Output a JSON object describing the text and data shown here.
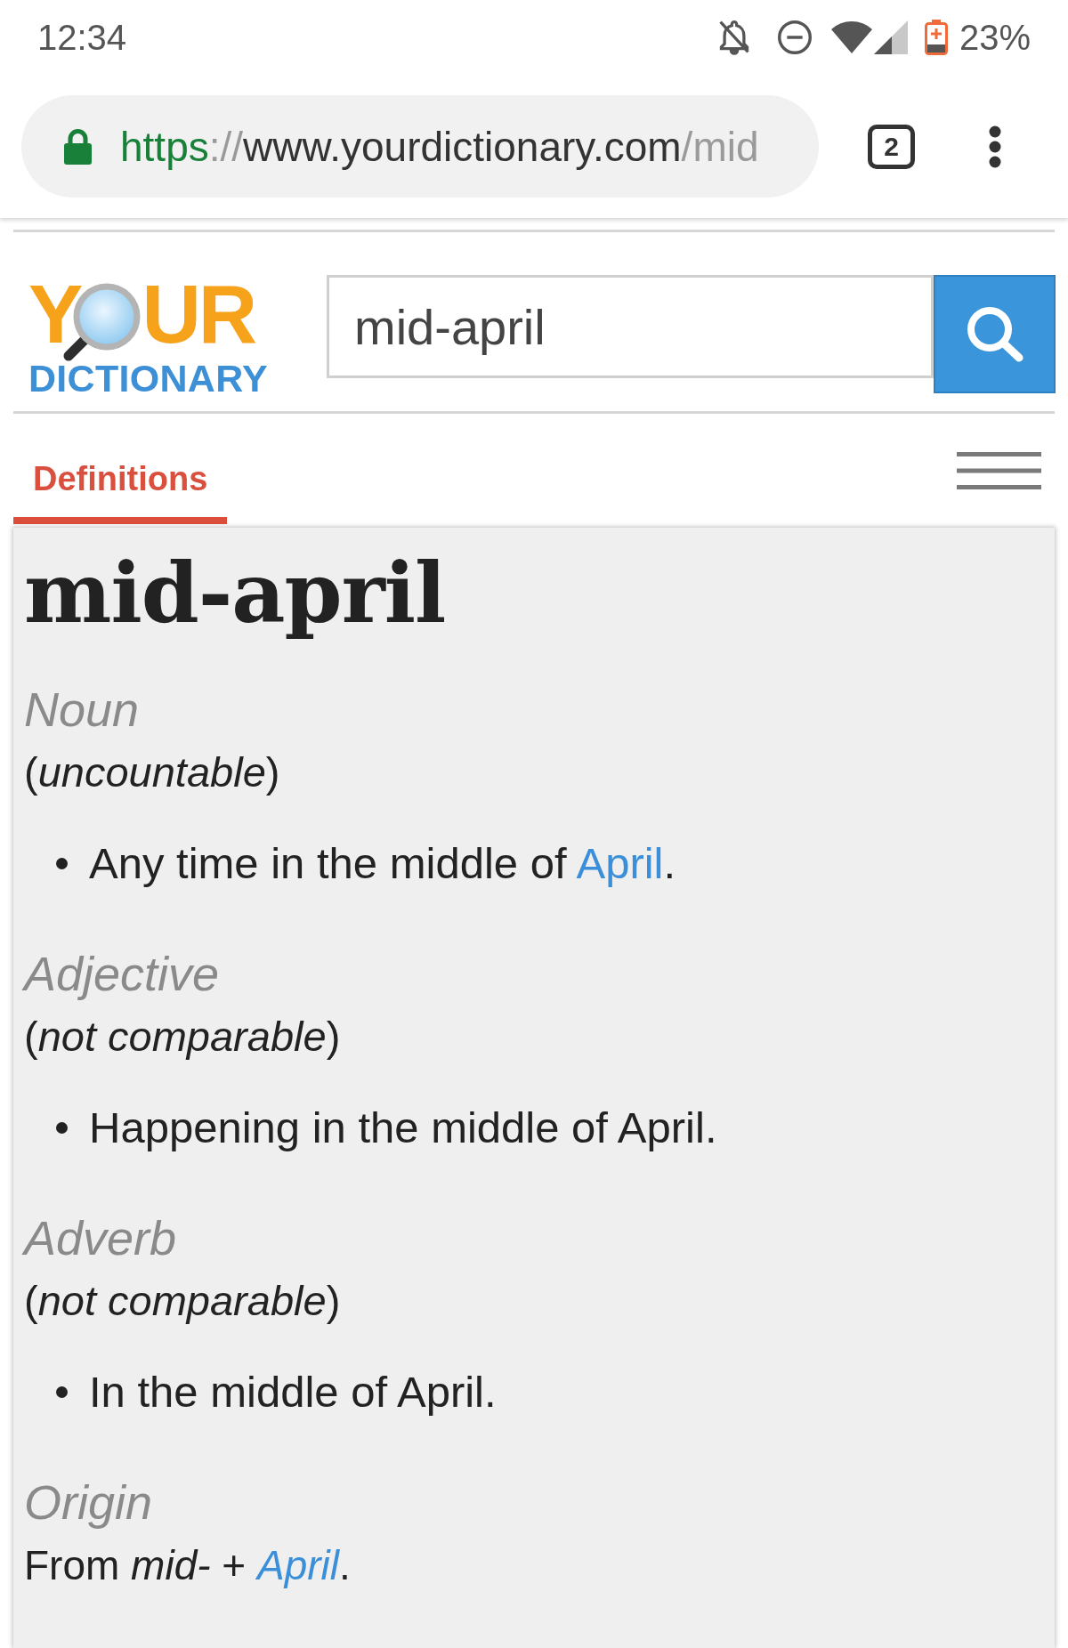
{
  "status_bar": {
    "time": "12:34",
    "battery_percent": "23%"
  },
  "browser": {
    "address": {
      "scheme": "https",
      "separator": "://",
      "host": "www.yourdictionary.com",
      "path": "/mid"
    },
    "tab_count": "2"
  },
  "site_header": {
    "logo": {
      "word_start": "Y",
      "word_end": "UR",
      "subtitle": "DICTIONARY"
    },
    "search": {
      "value": "mid-april"
    }
  },
  "tabs": [
    {
      "label": "Definitions",
      "selected": true
    }
  ],
  "entry": {
    "headword": "mid-april",
    "senses": [
      {
        "part_of_speech": "Noun",
        "note": "(*uncountable*)",
        "definitions": [
          {
            "parts": [
              {
                "kind": "text",
                "text": "Any time in the middle of "
              },
              {
                "kind": "link",
                "text": "April",
                "italic": false
              },
              {
                "kind": "text",
                "text": "."
              }
            ]
          }
        ]
      },
      {
        "part_of_speech": "Adjective",
        "note": "(*not comparable*)",
        "definitions": [
          {
            "parts": [
              {
                "kind": "text",
                "text": "Happening in the middle of April."
              }
            ]
          }
        ]
      },
      {
        "part_of_speech": "Adverb",
        "note": "(*not comparable*)",
        "definitions": [
          {
            "parts": [
              {
                "kind": "text",
                "text": "In the middle of April."
              }
            ]
          }
        ]
      }
    ],
    "origin": {
      "label": "Origin",
      "parts": [
        {
          "kind": "text",
          "text": "From *mid-* + "
        },
        {
          "kind": "link",
          "text": "April",
          "italic": true
        },
        {
          "kind": "text",
          "text": "."
        }
      ]
    }
  }
}
